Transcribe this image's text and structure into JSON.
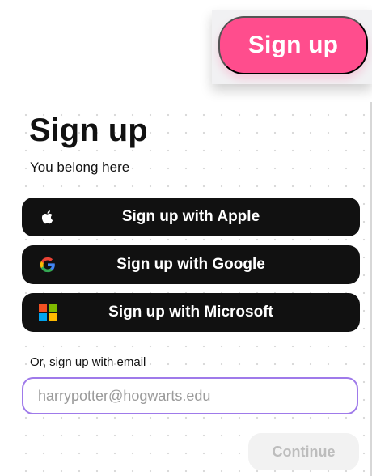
{
  "header": {
    "signup_button_label": "Sign up"
  },
  "form": {
    "title": "Sign up",
    "subtitle": "You belong here",
    "social_buttons": [
      {
        "label": "Sign up with Apple",
        "icon": "apple-icon"
      },
      {
        "label": "Sign up with Google",
        "icon": "google-icon"
      },
      {
        "label": "Sign up with Microsoft",
        "icon": "microsoft-icon"
      }
    ],
    "email_label": "Or, sign up with email",
    "email_placeholder": "harrypotter@hogwarts.edu",
    "continue_label": "Continue"
  },
  "colors": {
    "accent_pink": "#ff4d8d",
    "social_button_bg": "#111111",
    "input_border": "#9f7aea",
    "continue_bg": "#f2f2f2",
    "continue_text": "#bdbdbd"
  }
}
